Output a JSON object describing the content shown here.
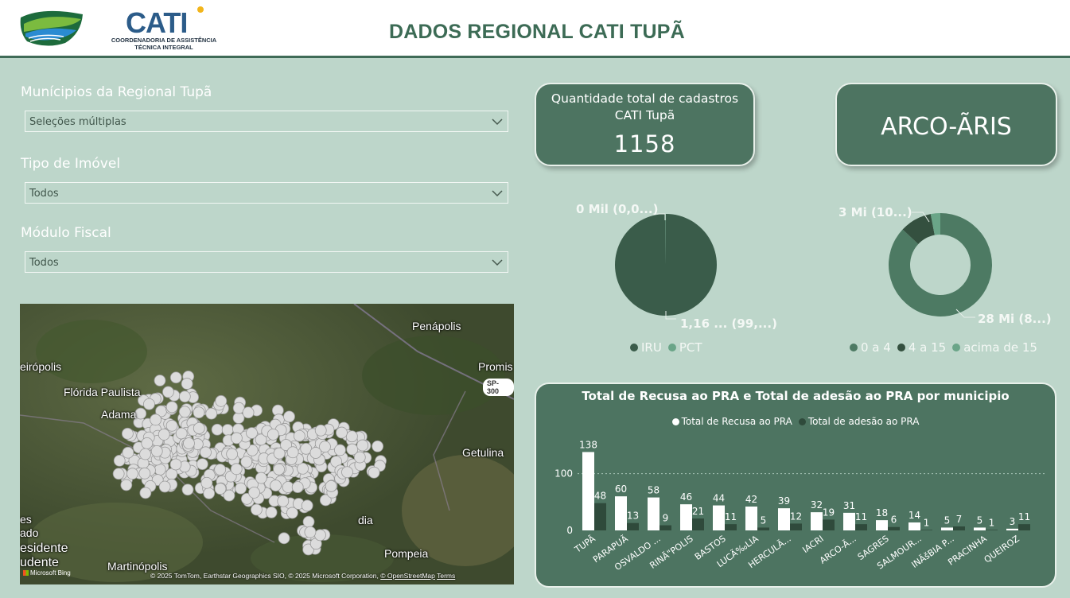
{
  "header": {
    "title": "DADOS REGIONAL CATI TUPÃ",
    "cati_logo_text": "CATI",
    "cati_logo_sub_line1": "COORDENADORIA DE ASSISTÊNCIA",
    "cati_logo_sub_line2": "TÉCNICA INTEGRAL"
  },
  "filters": {
    "municipios": {
      "label": "Munícipios da Regional Tupã",
      "value": "Seleções múltiplas"
    },
    "tipo_imovel": {
      "label": "Tipo de Imóvel",
      "value": "Todos"
    },
    "modulo_fiscal": {
      "label": "Módulo Fiscal",
      "value": "Todos"
    }
  },
  "map": {
    "places": [
      "Penápolis",
      "eirópolis",
      "Flórida Paulista",
      "Promis",
      "Adama",
      "Getulina",
      "es",
      "ado",
      "esidente",
      "udente",
      "Martinópolis",
      "Pompeia",
      "dia"
    ],
    "road_shield": "SP-300",
    "attribution": "© 2025 TomTom, Earthstar Geographics SIO, © 2025 Microsoft Corporation,",
    "attribution_link1": "© OpenStreetMap",
    "attribution_link2": "Terms",
    "bing": "Microsoft Bing"
  },
  "kpi_total": {
    "label_line1": "Quantidade total de cadastros",
    "label_line2": "CATI Tupã",
    "value": "1158"
  },
  "kpi_municipio": {
    "value": "ARCO-ÃRIS"
  },
  "pie_tipo": {
    "label_small": "0 Mil (0,0...)",
    "label_large": "1,16 ... (99,...)",
    "legend": [
      {
        "name": "IRU",
        "color": "#3a5c4a"
      },
      {
        "name": "PCT",
        "color": "#6aa588"
      }
    ],
    "slices": [
      {
        "name": "IRU",
        "value": 99.9,
        "color": "#3a5c4a"
      },
      {
        "name": "PCT",
        "value": 0.1,
        "color": "#6aa588"
      }
    ]
  },
  "donut_modulo": {
    "label_small": "3 Mi (10...)",
    "label_large": "28 Mi (8...)",
    "legend": [
      {
        "name": "0 a 4",
        "color": "#4d7a63"
      },
      {
        "name": "4 a 15",
        "color": "#34503f"
      },
      {
        "name": "acima de 15",
        "color": "#6aa588"
      }
    ],
    "slices": [
      {
        "name": "0 a 4",
        "value": 87,
        "color": "#4d7a63"
      },
      {
        "name": "4 a 15",
        "value": 10,
        "color": "#34503f"
      },
      {
        "name": "acima de 15",
        "value": 3,
        "color": "#6aa588"
      }
    ]
  },
  "chart_data": {
    "type": "bar",
    "title": "Total de Recusa ao PRA e Total de adesão ao PRA por municipio",
    "categories": [
      "TUPÃ",
      "PARAPUÃ",
      "OSVALDO ...",
      "RINÃ\"POLIS",
      "BASTOS",
      "LUCÃ‰LIA",
      "HERCULÃ...",
      "IACRI",
      "ARCO-Ã...",
      "SAGRES",
      "SALMOUR...",
      "INÃšBIA P...",
      "PRACINHA",
      "QUEIROZ"
    ],
    "series": [
      {
        "name": "Total de Recusa ao PRA",
        "color": "#ffffff",
        "values": [
          138,
          60,
          58,
          46,
          44,
          42,
          39,
          32,
          31,
          18,
          14,
          5,
          5,
          3
        ]
      },
      {
        "name": "Total de adesão ao PRA",
        "color": "#2f4a3b",
        "values": [
          48,
          13,
          9,
          21,
          11,
          5,
          12,
          19,
          11,
          6,
          1,
          7,
          1,
          11
        ]
      }
    ],
    "yticks": [
      0,
      100
    ],
    "ylim": [
      0,
      140
    ],
    "grid": true
  }
}
